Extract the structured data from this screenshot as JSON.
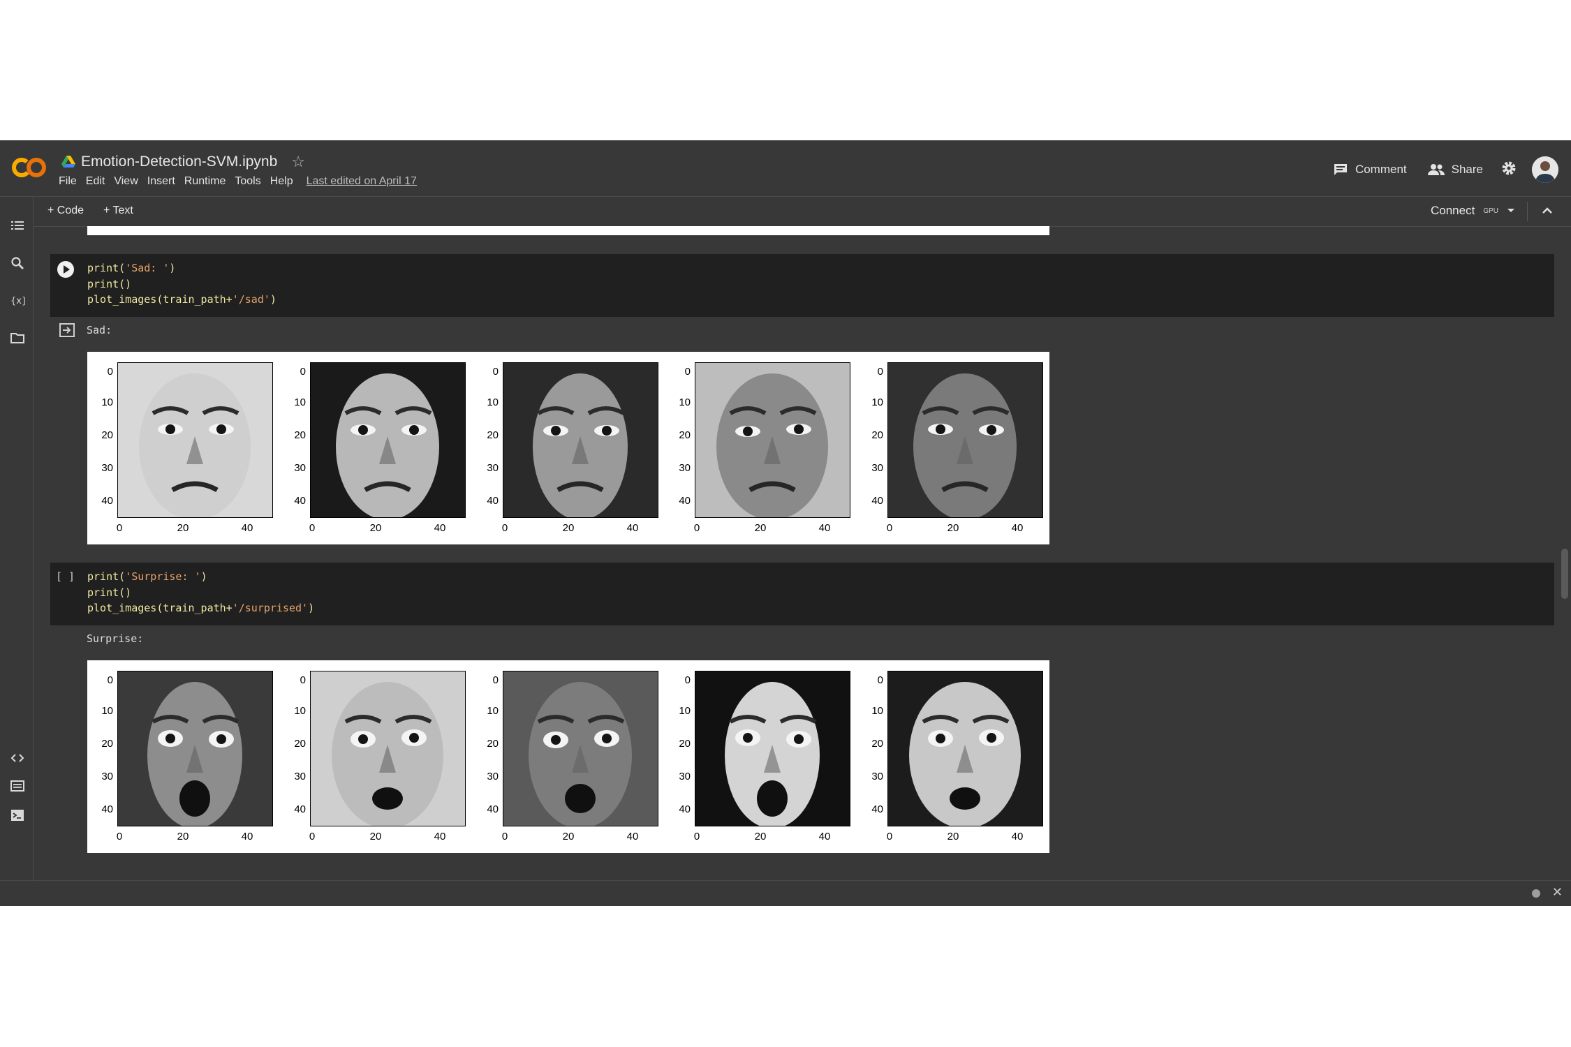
{
  "app": {
    "title": "Emotion-Detection-SVM.ipynb",
    "menu": [
      "File",
      "Edit",
      "View",
      "Insert",
      "Runtime",
      "Tools",
      "Help"
    ],
    "last_edited": "Last edited on April 17",
    "comment_label": "Comment",
    "share_label": "Share"
  },
  "toolbar": {
    "add_code": "+ Code",
    "add_text": "+ Text",
    "connect": "Connect",
    "gpu": "GPU"
  },
  "colors": {
    "background": "#383838",
    "code_cell": "#202020",
    "string": "#e6a26a",
    "function": "#f0e8a0"
  },
  "icons": [
    "table-of-contents-icon",
    "search-icon",
    "variables-icon",
    "folder-icon",
    "code-snippets-icon",
    "command-palette-icon",
    "terminal-icon"
  ],
  "cells": [
    {
      "bracket": "",
      "code_lines": [
        {
          "p1": "print(",
          "s": "'Sad: '",
          "p2": ")"
        },
        {
          "p1": "print()",
          "s": "",
          "p2": ""
        },
        {
          "p1": "plot_images(train_path+",
          "s": "'/sad'",
          "p2": ")"
        }
      ],
      "output_text": "Sad:",
      "figure": {
        "y_ticks": [
          "0",
          "10",
          "20",
          "30",
          "40"
        ],
        "x_ticks": [
          "0",
          "20",
          "40"
        ],
        "images": 5
      }
    },
    {
      "bracket": "[ ]",
      "code_lines": [
        {
          "p1": "print(",
          "s": "'Surprise: '",
          "p2": ")"
        },
        {
          "p1": "print()",
          "s": "",
          "p2": ""
        },
        {
          "p1": "plot_images(train_path+",
          "s": "'/surprised'",
          "p2": ")"
        }
      ],
      "output_text": "Surprise:",
      "figure": {
        "y_ticks": [
          "0",
          "10",
          "20",
          "30",
          "40"
        ],
        "x_ticks": [
          "0",
          "20",
          "40"
        ],
        "images": 5
      }
    }
  ]
}
